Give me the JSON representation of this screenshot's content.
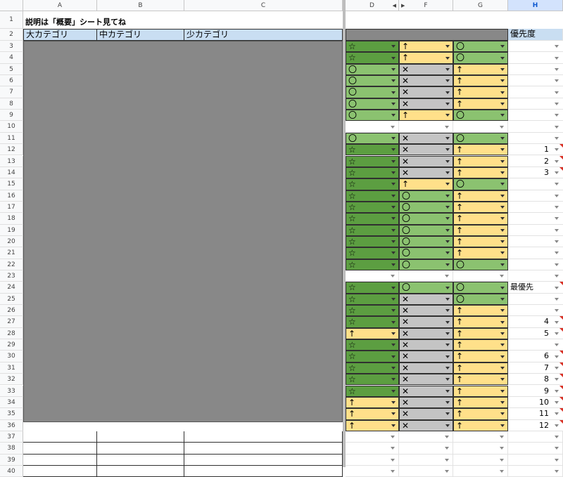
{
  "columns": {
    "A": "A",
    "B": "B",
    "C": "C",
    "D": "D",
    "F": "F",
    "G": "G",
    "H": "H"
  },
  "rows": [
    "1",
    "2",
    "3",
    "4",
    "5",
    "6",
    "7",
    "8",
    "9",
    "10",
    "11",
    "12",
    "13",
    "14",
    "15",
    "16",
    "17",
    "18",
    "19",
    "20",
    "21",
    "22",
    "23",
    "24",
    "25",
    "26",
    "27",
    "28",
    "29",
    "30",
    "31",
    "32",
    "33",
    "34",
    "35",
    "36",
    "37",
    "38",
    "39",
    "40"
  ],
  "note": "説明は「概要」シート見てね",
  "headers": {
    "A": "大カテゴリ",
    "B": "中カテゴリ",
    "C": "少カテゴリ",
    "H": "優先度"
  },
  "h24": "最優先",
  "colors": {
    "star": "#5c9e41",
    "circle": "#8bc270",
    "arrow": "#ffe08a",
    "cross": "#c4c4c4",
    "header_blue": "#c9def2",
    "grey_block": "#888888"
  },
  "symbols": {
    "star": "☆",
    "circle": "〇",
    "arrow": "↑",
    "cross": "✕"
  },
  "grid": [
    {
      "row": 3,
      "D": "star",
      "F": "arrow",
      "G": "circle",
      "H": ""
    },
    {
      "row": 4,
      "D": "star",
      "F": "arrow",
      "G": "circle",
      "H": ""
    },
    {
      "row": 5,
      "D": "circle",
      "F": "cross",
      "G": "arrow",
      "H": ""
    },
    {
      "row": 6,
      "D": "circle",
      "F": "cross",
      "G": "arrow",
      "H": ""
    },
    {
      "row": 7,
      "D": "circle",
      "F": "cross",
      "G": "arrow",
      "H": ""
    },
    {
      "row": 8,
      "D": "circle",
      "F": "cross",
      "G": "arrow",
      "H": ""
    },
    {
      "row": 9,
      "D": "circle",
      "F": "arrow",
      "G": "circle",
      "H": ""
    },
    {
      "row": 10,
      "D": "",
      "F": "",
      "G": "",
      "H": ""
    },
    {
      "row": 11,
      "D": "circle",
      "F": "cross",
      "G": "circle",
      "H": ""
    },
    {
      "row": 12,
      "D": "star",
      "F": "cross",
      "G": "arrow",
      "H": "1"
    },
    {
      "row": 13,
      "D": "star",
      "F": "cross",
      "G": "arrow",
      "H": "2"
    },
    {
      "row": 14,
      "D": "star",
      "F": "cross",
      "G": "arrow",
      "H": "3"
    },
    {
      "row": 15,
      "D": "star",
      "F": "arrow",
      "G": "circle",
      "H": ""
    },
    {
      "row": 16,
      "D": "star",
      "F": "circle",
      "G": "arrow",
      "H": ""
    },
    {
      "row": 17,
      "D": "star",
      "F": "circle",
      "G": "arrow",
      "H": ""
    },
    {
      "row": 18,
      "D": "star",
      "F": "circle",
      "G": "arrow",
      "H": ""
    },
    {
      "row": 19,
      "D": "star",
      "F": "circle",
      "G": "arrow",
      "H": ""
    },
    {
      "row": 20,
      "D": "star",
      "F": "circle",
      "G": "arrow",
      "H": ""
    },
    {
      "row": 21,
      "D": "star",
      "F": "circle",
      "G": "arrow",
      "H": ""
    },
    {
      "row": 22,
      "D": "star",
      "F": "circle",
      "G": "circle",
      "H": ""
    },
    {
      "row": 23,
      "D": "",
      "F": "",
      "G": "",
      "H": ""
    },
    {
      "row": 24,
      "D": "star",
      "F": "circle",
      "G": "circle",
      "H": "最優先"
    },
    {
      "row": 25,
      "D": "star",
      "F": "cross",
      "G": "circle",
      "H": ""
    },
    {
      "row": 26,
      "D": "star",
      "F": "cross",
      "G": "arrow",
      "H": ""
    },
    {
      "row": 27,
      "D": "star",
      "F": "cross",
      "G": "arrow",
      "H": "4"
    },
    {
      "row": 28,
      "D": "arrow",
      "F": "cross",
      "G": "arrow",
      "H": "5"
    },
    {
      "row": 29,
      "D": "star",
      "F": "cross",
      "G": "arrow",
      "H": ""
    },
    {
      "row": 30,
      "D": "star",
      "F": "cross",
      "G": "arrow",
      "H": "6"
    },
    {
      "row": 31,
      "D": "star",
      "F": "cross",
      "G": "arrow",
      "H": "7"
    },
    {
      "row": 32,
      "D": "star",
      "F": "cross",
      "G": "arrow",
      "H": "8"
    },
    {
      "row": 33,
      "D": "star",
      "F": "cross",
      "G": "arrow",
      "H": "9"
    },
    {
      "row": 34,
      "D": "arrow",
      "F": "cross",
      "G": "arrow",
      "H": "10"
    },
    {
      "row": 35,
      "D": "arrow",
      "F": "cross",
      "G": "arrow",
      "H": "11"
    },
    {
      "row": 36,
      "D": "arrow",
      "F": "cross",
      "G": "arrow",
      "H": "12"
    }
  ]
}
